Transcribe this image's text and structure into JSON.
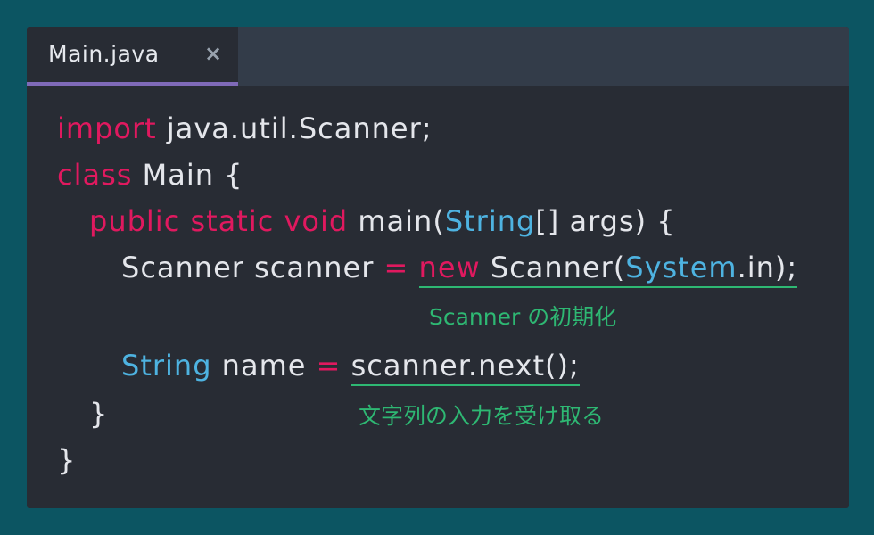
{
  "tab": {
    "title": "Main.java",
    "close": "×"
  },
  "code": {
    "line1": {
      "kw": "import",
      "rest": " java.util.Scanner;"
    },
    "line2": {
      "kw": "class",
      "rest": " Main {"
    },
    "line3": {
      "kw": "public static void",
      "mid": " main(",
      "type": "String",
      "rest": "[] args) {"
    },
    "line4": {
      "lead": "Scanner scanner ",
      "op": "=",
      "sp": " ",
      "kw": "new",
      "mid": " Scanner(",
      "type": "System",
      "rest": ".in);"
    },
    "line5": {
      "type": "String",
      "mid": " name ",
      "op": "=",
      "sp": " ",
      "expr": "scanner.next();"
    },
    "line6": "}",
    "line7": "}"
  },
  "annotations": {
    "init": "Scanner の初期化",
    "input": "文字列の入力を受け取る"
  },
  "colors": {
    "background": "#0c5562",
    "editor": "#282c34",
    "tabbar": "#333c49",
    "tab_indicator": "#7f6ab8",
    "keyword": "#e0195f",
    "type": "#4eb3e1",
    "annotation": "#2eb873",
    "text": "#e4e6eb"
  }
}
